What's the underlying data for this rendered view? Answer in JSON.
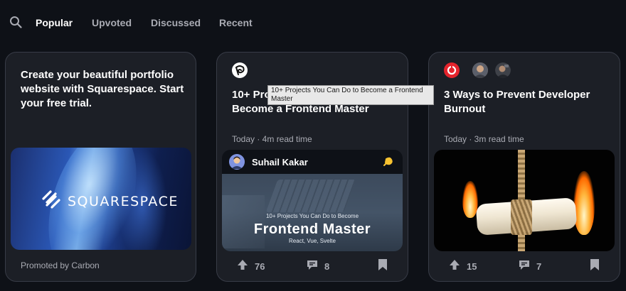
{
  "nav": {
    "search_icon": "search-icon",
    "tabs": [
      {
        "label": "Popular",
        "active": true
      },
      {
        "label": "Upvoted",
        "active": false
      },
      {
        "label": "Discussed",
        "active": false
      },
      {
        "label": "Recent",
        "active": false
      }
    ]
  },
  "ad_card": {
    "text": "Create your beautiful portfolio website with Squarespace. Start your free trial.",
    "logo_text": "SQUARESPACE",
    "footer": "Promoted by Carbon"
  },
  "cards": [
    {
      "title": "10+ Projects You Can Do to Become a Frontend Master",
      "meta": "Today · 4m read time",
      "author": "Suhail Kakar",
      "image_small_text": "10+ Projects You Can Do to Become",
      "image_big_text": "Frontend Master",
      "image_tags": "React, Vue, Svelte",
      "upvotes": "76",
      "comments": "8",
      "tooltip": "10+ Projects You Can Do to Become a Frontend Master"
    },
    {
      "title": "3 Ways to Prevent Developer Burnout",
      "meta": "Today · 3m read time",
      "upvotes": "15",
      "comments": "7"
    }
  ],
  "colors": {
    "background": "#0e1117",
    "card": "#1c1f26",
    "border": "#383c47",
    "muted_text": "#a9abb3",
    "source_red": "#e4242d",
    "badge_yellow": "#f8c331"
  }
}
